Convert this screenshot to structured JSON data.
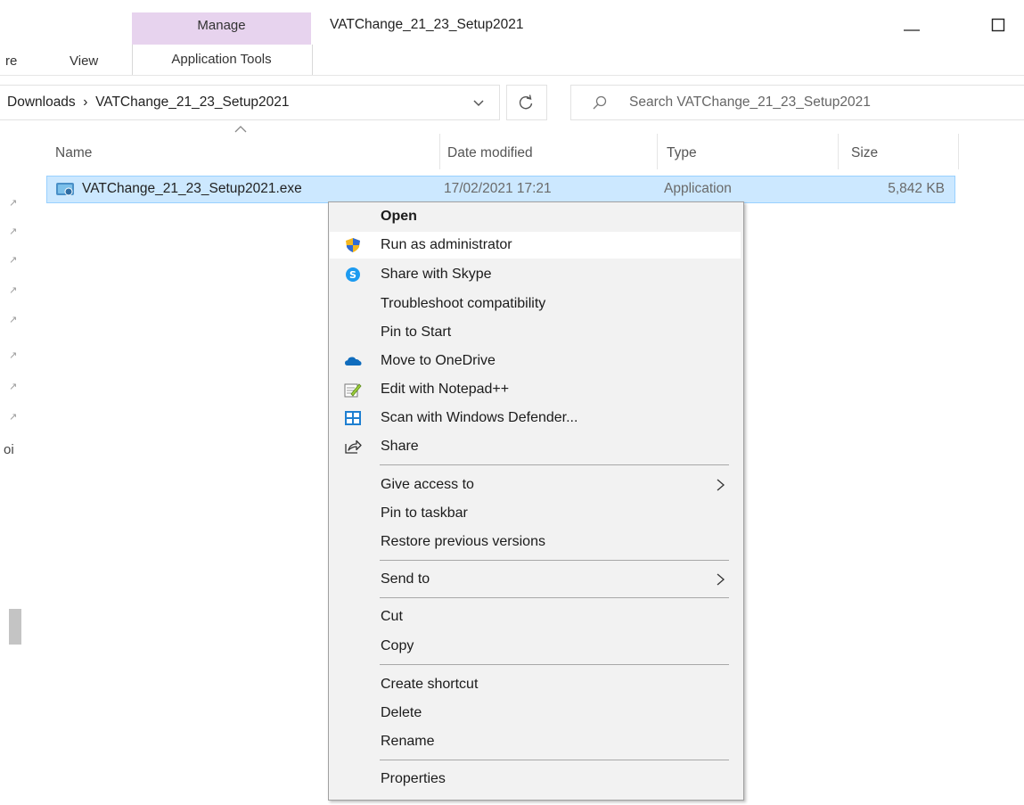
{
  "window": {
    "title": "VATChange_21_23_Setup2021",
    "minimize_icon": "minimize-icon",
    "maximize_icon": "maximize-icon"
  },
  "ribbon": {
    "contextual_group_label": "Manage",
    "contextual_group_color": "#e7d3ee",
    "tabs": [
      "re",
      "View",
      "Application Tools"
    ]
  },
  "address": {
    "path": "Downloads  ›  VATChange_21_23_Setup2021",
    "search_placeholder": "Search VATChange_21_23_Setup2021"
  },
  "columns": [
    "Name",
    "Date modified",
    "Type",
    "Size"
  ],
  "files": [
    {
      "name": "VATChange_21_23_Setup2021.exe",
      "date_modified": "17/02/2021 17:21",
      "type": "Application",
      "size": "5,842 KB",
      "selected": true
    }
  ],
  "nav_fragment": "oi",
  "selection_color": "#cce8ff",
  "context_menu": {
    "items": [
      {
        "label": "Open",
        "bold": true,
        "icon": null
      },
      {
        "label": "Run as administrator",
        "icon": "uac-shield-icon",
        "hovered": true
      },
      {
        "label": "Share with Skype",
        "icon": "skype-icon"
      },
      {
        "label": "Troubleshoot compatibility",
        "icon": null
      },
      {
        "label": "Pin to Start",
        "icon": null
      },
      {
        "label": "Move to OneDrive",
        "icon": "onedrive-cloud-icon"
      },
      {
        "label": "Edit with Notepad++",
        "icon": "notepad-plus-plus-icon"
      },
      {
        "label": "Scan with Windows Defender...",
        "icon": "windows-defender-icon"
      },
      {
        "label": "Share",
        "icon": "share-icon"
      },
      {
        "label": "Give access to",
        "submenu": true
      },
      {
        "label": "Pin to taskbar"
      },
      {
        "label": "Restore previous versions"
      },
      {
        "label": "Send to",
        "submenu": true
      },
      {
        "label": "Cut"
      },
      {
        "label": "Copy"
      },
      {
        "label": "Create shortcut"
      },
      {
        "label": "Delete"
      },
      {
        "label": "Rename"
      },
      {
        "label": "Properties"
      }
    ]
  }
}
